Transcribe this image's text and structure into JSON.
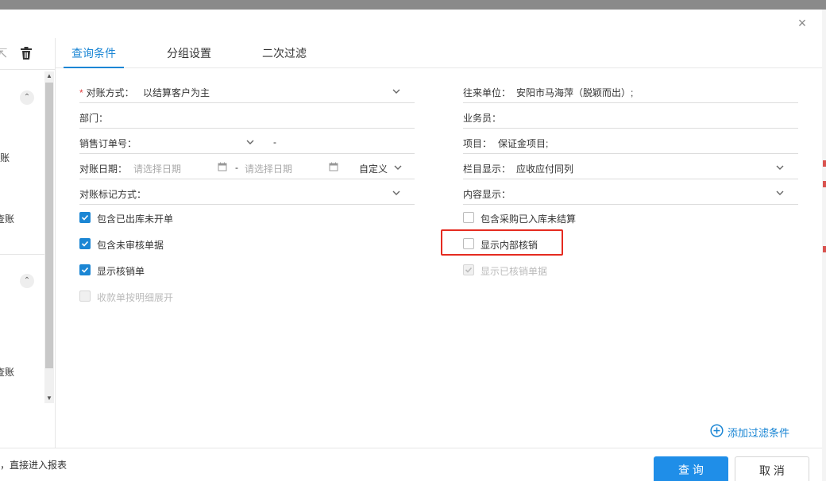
{
  "modal": {
    "close_glyph": "×"
  },
  "sidebar": {
    "frag1": "账",
    "frag2": "查账",
    "frag3": "查账",
    "up_arrow": "▲",
    "down_arrow": "▼",
    "collapse_glyph": "⌃"
  },
  "tabs": [
    {
      "label": "查询条件",
      "active": true
    },
    {
      "label": "分组设置",
      "active": false
    },
    {
      "label": "二次过滤",
      "active": false
    }
  ],
  "left_fields": {
    "reconcile_method": {
      "required_mark": "*",
      "label": "对账方式：",
      "value": "以结算客户为主"
    },
    "department": {
      "label": "部门："
    },
    "sales_order": {
      "label": "销售订单号：",
      "sep": "-"
    },
    "reconcile_date": {
      "label": "对账日期：",
      "start_placeholder": "请选择日期",
      "end_placeholder": "请选择日期",
      "sep": "-",
      "preset": "自定义"
    },
    "mark_method": {
      "label": "对账标记方式："
    }
  },
  "right_fields": {
    "counterparty": {
      "label": "往来单位：",
      "value": "安阳市马海萍（脱颖而出）;"
    },
    "salesperson": {
      "label": "业务员："
    },
    "project": {
      "label": "项目：",
      "value": "保证金项目;"
    },
    "column_display": {
      "label": "栏目显示：",
      "value": "应收应付同列"
    },
    "content_display": {
      "label": "内容显示："
    }
  },
  "left_checks": [
    {
      "label": "包含已出库未开单",
      "checked": true,
      "disabled": false
    },
    {
      "label": "包含未审核单据",
      "checked": true,
      "disabled": false
    },
    {
      "label": "显示核销单",
      "checked": true,
      "disabled": false
    },
    {
      "label": "收款单按明细展开",
      "checked": false,
      "disabled": true
    }
  ],
  "right_checks": [
    {
      "label": "包含采购已入库未结算",
      "checked": false,
      "disabled": false
    },
    {
      "label": "显示内部核销",
      "checked": false,
      "disabled": false
    },
    {
      "label": "显示已核销单据",
      "checked": true,
      "disabled": true
    }
  ],
  "add_filter": {
    "label": "添加过滤条件"
  },
  "footer": {
    "note": "，直接进入报表",
    "query_label": "查 询",
    "cancel_label": "取 消"
  },
  "colors": {
    "accent": "#1b86d4",
    "primary_button": "#1f8ee8",
    "highlight": "#e52b20",
    "required": "#e23e3e"
  },
  "icons": [
    "close-icon",
    "trash-icon",
    "chevron-down-icon",
    "calendar-icon",
    "check-icon",
    "plus-circle-icon"
  ]
}
